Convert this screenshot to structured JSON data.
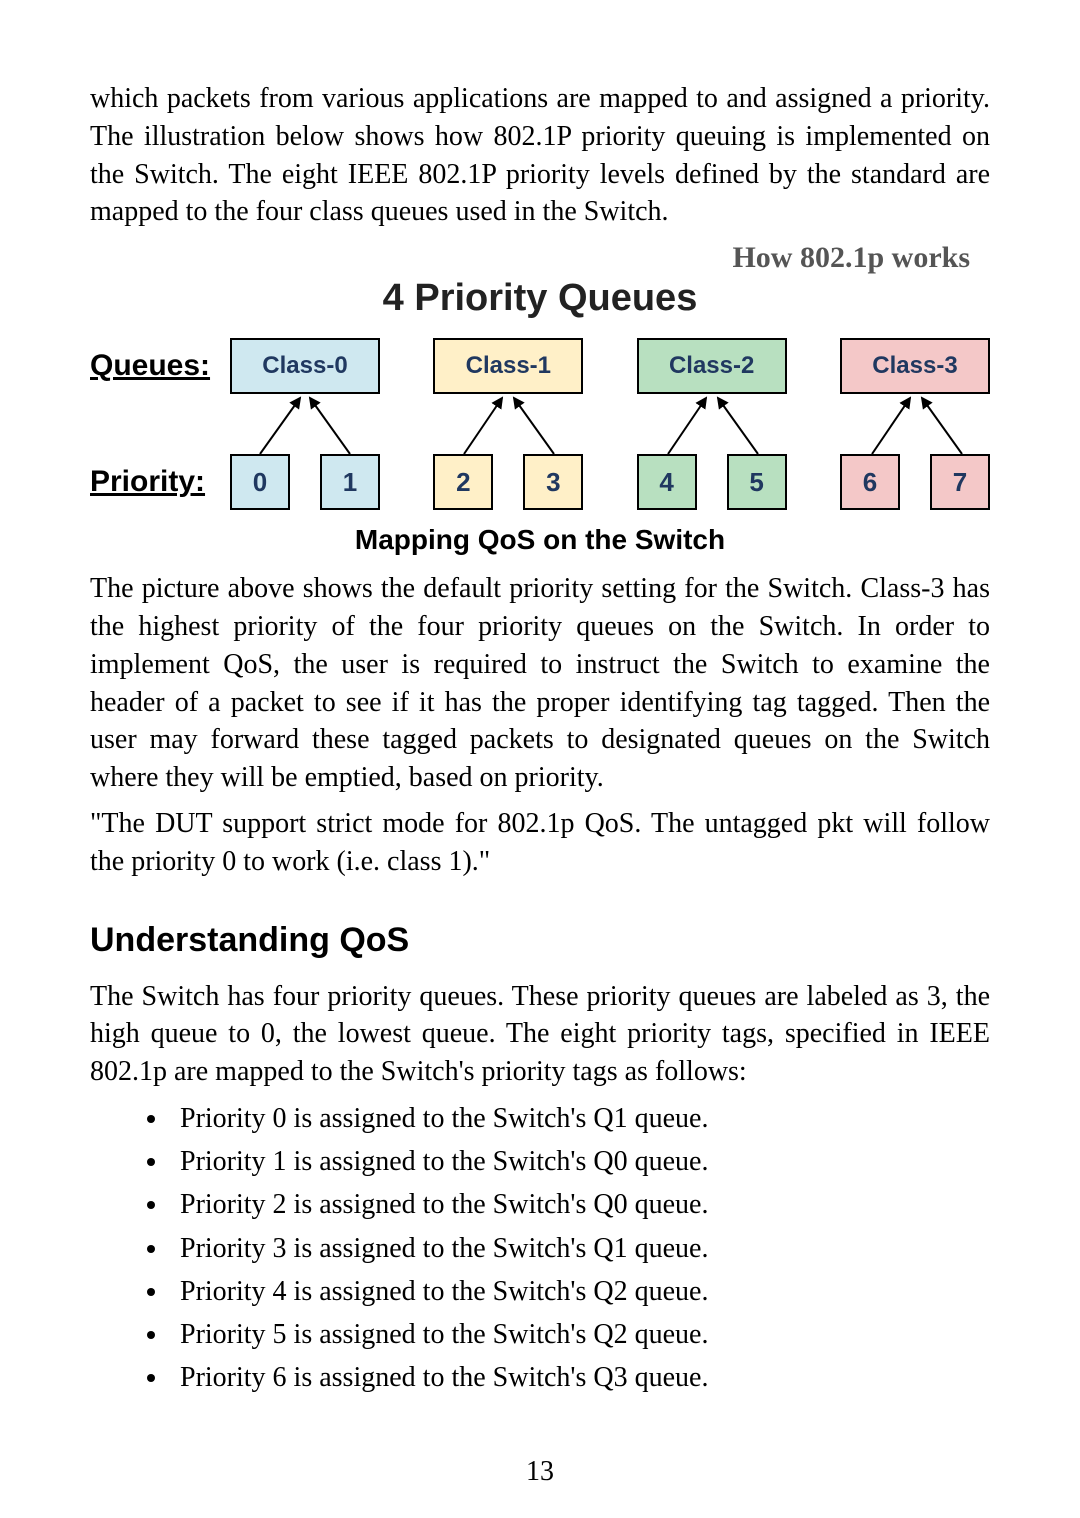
{
  "intro_para": "which packets from various applications are mapped to and assigned a priority. The illustration below shows how 802.1P priority queuing is implemented on the Switch. The eight IEEE 802.1P priority levels defined by the standard are mapped to the four class queues used in the Switch.",
  "diagram": {
    "how_label": "How 802.1p works",
    "title": "4 Priority Queues",
    "queues_label": "Queues:",
    "priority_label": "Priority:",
    "queue_classes": [
      "Class-0",
      "Class-1",
      "Class-2",
      "Class-3"
    ],
    "priorities": [
      "0",
      "1",
      "2",
      "3",
      "4",
      "5",
      "6",
      "7"
    ],
    "caption": "Mapping QoS on the Switch"
  },
  "para2": "The picture above shows the default priority setting for the Switch. Class-3 has the highest priority of the four priority queues on the Switch. In order to implement QoS, the user is required to instruct the Switch to examine the header of a packet to see if it has the proper identifying tag tagged. Then the user may forward these tagged packets to designated queues on the Switch where they will be emptied, based on priority.",
  "para3": "\"The DUT support strict mode for 802.1p QoS. The untagged pkt will follow the priority 0 to work (i.e. class 1).\"",
  "section_heading": "Understanding QoS",
  "para4": "The Switch has four priority queues. These priority queues are labeled as 3, the high queue to 0, the lowest queue. The eight priority tags, specified in IEEE 802.1p are mapped to the Switch's priority tags as follows:",
  "bullets": [
    "Priority 0 is assigned to the Switch's Q1 queue.",
    "Priority 1 is assigned to the Switch's Q0 queue.",
    "Priority 2 is assigned to the Switch's Q0 queue.",
    "Priority 3 is assigned to the Switch's Q1 queue.",
    "Priority 4 is assigned to the Switch's Q2 queue.",
    "Priority 5 is assigned to the Switch's Q2 queue.",
    "Priority 6 is assigned to the Switch's Q3 queue."
  ],
  "page_number": "13",
  "chart_data": {
    "type": "table",
    "title": "4 Priority Queues — 802.1p priority to class-queue mapping on the Switch",
    "columns": [
      "priority_level",
      "class_queue"
    ],
    "rows": [
      {
        "priority_level": 0,
        "class_queue": "Class-0"
      },
      {
        "priority_level": 1,
        "class_queue": "Class-0"
      },
      {
        "priority_level": 2,
        "class_queue": "Class-1"
      },
      {
        "priority_level": 3,
        "class_queue": "Class-1"
      },
      {
        "priority_level": 4,
        "class_queue": "Class-2"
      },
      {
        "priority_level": 5,
        "class_queue": "Class-2"
      },
      {
        "priority_level": 6,
        "class_queue": "Class-3"
      },
      {
        "priority_level": 7,
        "class_queue": "Class-3"
      }
    ]
  }
}
